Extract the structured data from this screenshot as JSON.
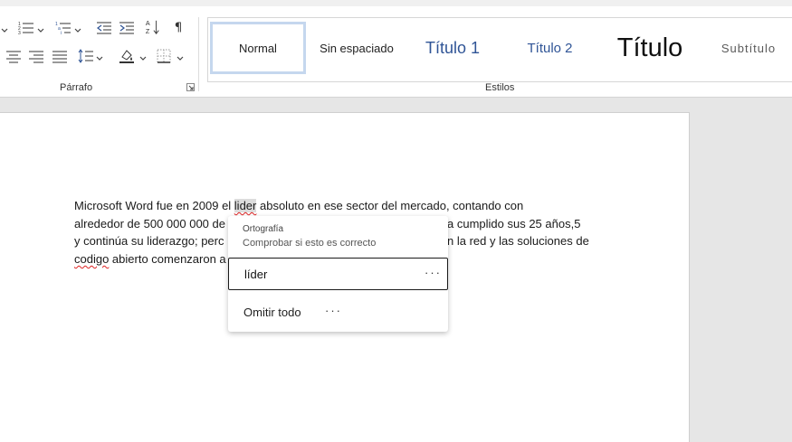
{
  "ribbon": {
    "paragraph_group_label": "Párrafo",
    "styles_group_label": "Estilos",
    "styles": [
      {
        "label": "Normal",
        "selected": true
      },
      {
        "label": "Sin espaciado",
        "selected": false
      },
      {
        "label": "Título 1",
        "selected": false
      },
      {
        "label": "Título 2",
        "selected": false
      },
      {
        "label": "Título",
        "selected": false
      },
      {
        "label": "Subtítulo",
        "selected": false
      }
    ],
    "heading_color": "#2f5496"
  },
  "document": {
    "line1_before": "Microsoft Word fue en 2009 el ",
    "line1_word": "lider",
    "line1_after": " absoluto en ese sector del mercado, contando con",
    "line2_before": "alrededor de 500 000 000 de",
    "line2_after": "a cumplido sus 25 años,5",
    "line3_before": "y continúa su liderazgo; perc",
    "line3_after": "n la red y las soluciones de",
    "line4_word": "codigo",
    "line4_after": " abierto comenzaron a"
  },
  "spell_popup": {
    "category": "Ortografía",
    "hint": "Comprobar si esto es correcto",
    "suggestion": "líder",
    "suggestion_more": "···",
    "ignore_all": "Omitir todo",
    "ignore_more": "···"
  }
}
